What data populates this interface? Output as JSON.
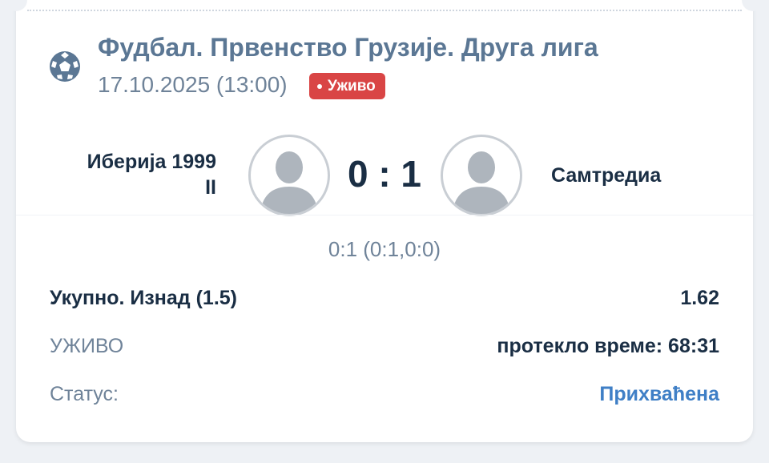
{
  "event": {
    "league": "Фудбал. Првенство Грузије. Друга лига",
    "datetime": "17.10.2025 (13:00)",
    "live_badge": "Уживо",
    "sport_icon": "soccer-ball-icon"
  },
  "match": {
    "home_team_line1": "Иберија 1999",
    "home_team_line2": "II",
    "away_team": "Самтредиа",
    "score": "0 : 1",
    "halftime_detail": "0:1 (0:1,0:0)"
  },
  "bet": {
    "market_label": "Укупно. Изнад (1.5)",
    "odds": "1.62",
    "live_label": "УЖИВО",
    "elapsed_label": "протекло време: 68:31",
    "status_label": "Статус:",
    "status_value": "Прихваћена"
  },
  "colors": {
    "accent_blue": "#3f7fc6",
    "live_red": "#d94545",
    "dark_text": "#1a2e44",
    "muted_text": "#6f8399"
  }
}
